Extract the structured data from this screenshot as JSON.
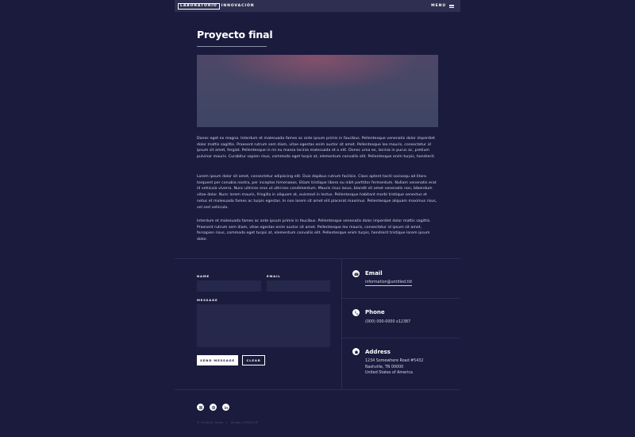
{
  "header": {
    "logo_part1": "LABORATORIO",
    "logo_part2": "INNOVACIÓN",
    "menu_label": "MENU"
  },
  "page": {
    "title": "Proyecto final",
    "paragraphs": [
      "Donec eget ex magna. Interdum et malesuada fames ac ante ipsum primis in faucibus. Pellentesque venenatis dolor imperdiet dolor mattis sagittis. Praesent rutrum sem diam, vitae egestas enim auctor sit amet. Pellentesque leo mauris, consectetur id ipsum sit amet, fergiat. Pellentesque in mi eu massa lacinia malesuada et a elit. Donec urna ex, lacinia in purus ac, pretium pulvinar mauris. Curabitur sapien risus, commodo eget turpis at, elementum convallis elit. Pellentesque enim turpis, hendrerit.",
      "Lorem ipsum dolor sit amet, consectetur adipiscing elit. Duis dapibus rutrum facilisis. Class aptent taciti sociosqu ad litora torquent per conubia nostra, per inceptos himenaeos. Etiam tristique libero eu nibh porttitor fermentum. Nullam venenatis erat id vehicula viverra. Nunc ultrices eros ut ultricies condimentum. Mauris risus lacus, blandit sit amet venenatis non, bibendum vitae dolor. Nunc lorem mauris, fringilla in aliquam at, euismod in lectus. Pellentesque habitant morbi tristique senectus et netus et malesuada fames ac turpis egestas. In non lorem sit amet elit placerat maximus. Pellentesque aliquam maximus risus, vel sed vehicula.",
      "Interdum et malesuada fames ac ante ipsum primis in faucibus. Pellentesque venenatis dolor imperdiet dolor mattis sagittis. Praesent rutrum sem diam, vitae egestas enim auctor sit amet. Pellentesque leo mauris, consectetur id ipsum sit amet, fersapien risus, commodo eget turpis at, elementum convallis elit. Pellentesque enim turpis, hendrerit tristique lorem ipsum dolor."
    ]
  },
  "form": {
    "name_label": "NAME",
    "name_value": "",
    "email_label": "EMAIL",
    "email_value": "",
    "message_label": "MESSAGE",
    "message_value": "",
    "send_label": "SEND MESSAGE",
    "clear_label": "CLEAR"
  },
  "contact": {
    "email_heading": "Email",
    "email_value": "information@untitled.tld",
    "phone_heading": "Phone",
    "phone_value": "(000) 000-0000 x12387",
    "address_heading": "Address",
    "address_lines": [
      "1234 Somewhere Road #5432",
      "Nashville, TN 00000",
      "United States of America"
    ]
  },
  "social": {
    "icons": [
      "instagram-icon",
      "dribbble-icon",
      "linkedin-icon"
    ]
  },
  "footer": {
    "copyright": "© Untitled. Todos",
    "design": "Design: HTML5 UP"
  },
  "colors": {
    "background": "#1b1b3d",
    "header": "#2d3050",
    "field": "#25274b",
    "text": "#d4d6e6"
  }
}
